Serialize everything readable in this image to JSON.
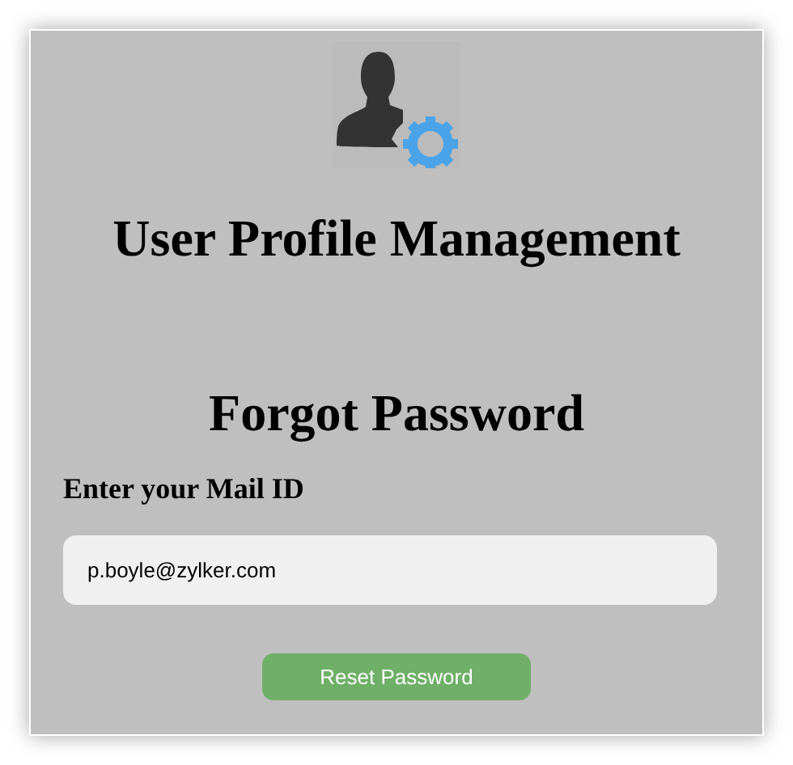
{
  "header": {
    "title": "User Profile Management"
  },
  "form": {
    "heading": "Forgot Password",
    "label": "Enter your Mail ID",
    "email": {
      "value": "p.boyle@zylker.com"
    },
    "button": "Reset Password"
  }
}
